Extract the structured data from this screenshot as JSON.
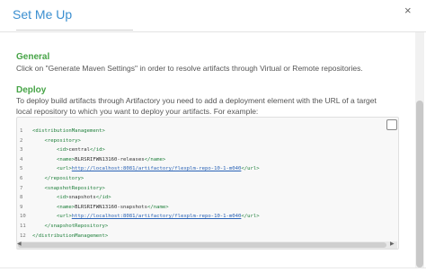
{
  "dialog": {
    "title": "Set Me Up",
    "close_glyph": "×"
  },
  "sections": {
    "general": {
      "heading": "General",
      "text": "Click on \"Generate Maven Settings\" in order to resolve artifacts through Virtual or Remote repositories."
    },
    "deploy": {
      "heading": "Deploy",
      "text": "To deploy build artifacts through Artifactory you need to add a deployment element with the URL of a target local repository to which you want to deploy your artifacts. For example:"
    }
  },
  "code": {
    "lines": [
      {
        "num": "1",
        "indent": "",
        "open": "<distributionManagement>",
        "content": "",
        "close": ""
      },
      {
        "num": "2",
        "indent": "    ",
        "open": "<repository>",
        "content": "",
        "close": ""
      },
      {
        "num": "3",
        "indent": "        ",
        "open": "<id>",
        "content": "central",
        "close": "</id>"
      },
      {
        "num": "4",
        "indent": "        ",
        "open": "<name>",
        "content": "BLRSRIFWN13160-releases",
        "close": "</name>"
      },
      {
        "num": "5",
        "indent": "        ",
        "open": "<url>",
        "content": "http://localhost:8081/artifactory/flexplm-repo-10-1-m040",
        "close": "</url>",
        "is_url": true
      },
      {
        "num": "6",
        "indent": "    ",
        "open": "</repository>",
        "content": "",
        "close": ""
      },
      {
        "num": "7",
        "indent": "    ",
        "open": "<snapshotRepository>",
        "content": "",
        "close": ""
      },
      {
        "num": "8",
        "indent": "        ",
        "open": "<id>",
        "content": "snapshots",
        "close": "</id>"
      },
      {
        "num": "9",
        "indent": "        ",
        "open": "<name>",
        "content": "BLRSRIFWN13160-snapshots",
        "close": "</name>"
      },
      {
        "num": "10",
        "indent": "        ",
        "open": "<url>",
        "content": "http://localhost:8081/artifactory/flexplm-repo-10-1-m040",
        "close": "</url>",
        "is_url": true
      },
      {
        "num": "11",
        "indent": "    ",
        "open": "</snapshotRepository>",
        "content": "",
        "close": ""
      },
      {
        "num": "12",
        "indent": "",
        "open": "</distributionManagement>",
        "content": "",
        "close": ""
      }
    ]
  },
  "icons": {
    "copy": "copy-icon",
    "close": "close-icon"
  },
  "colors": {
    "title": "#3b8fd0",
    "heading": "#47a447",
    "tag": "#1e7f3a",
    "url": "#2a63b6"
  }
}
